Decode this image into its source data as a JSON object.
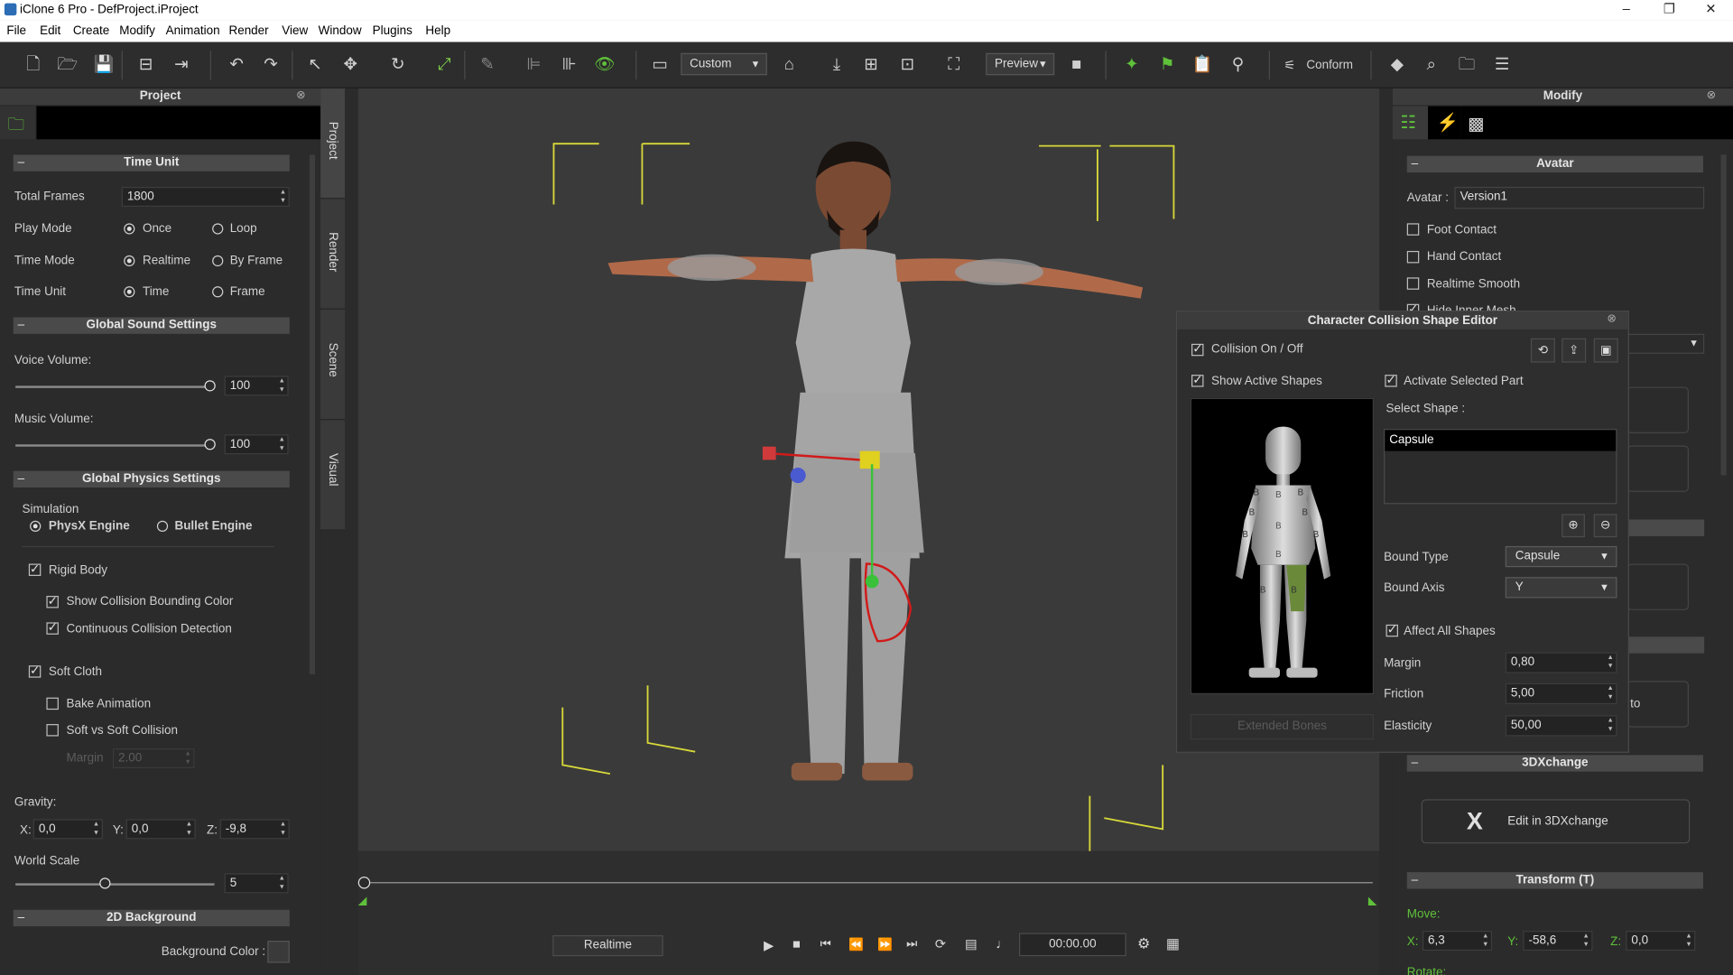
{
  "titlebar": {
    "title": "iClone 6 Pro - DefProject.iProject",
    "min": "–",
    "max": "❐",
    "close": "✕"
  },
  "menu": [
    "File",
    "Edit",
    "Create",
    "Modify",
    "Animation",
    "Render",
    "View",
    "Window",
    "Plugins",
    "Help"
  ],
  "toolbar": {
    "view_dropdown": "Custom",
    "preview_dropdown": "Preview",
    "conform": "Conform"
  },
  "left": {
    "title": "Project",
    "time_unit": {
      "header": "Time Unit",
      "total_frames_label": "Total Frames",
      "total_frames": "1800",
      "play_mode_label": "Play Mode",
      "once": "Once",
      "loop": "Loop",
      "time_mode_label": "Time Mode",
      "realtime": "Realtime",
      "by_frame": "By Frame",
      "time_unit_label": "Time Unit",
      "time": "Time",
      "frame": "Frame"
    },
    "sound": {
      "header": "Global Sound Settings",
      "voice_label": "Voice Volume:",
      "voice": "100",
      "music_label": "Music Volume:",
      "music": "100"
    },
    "physics": {
      "header": "Global Physics Settings",
      "simulation": "Simulation",
      "physx": "PhysX Engine",
      "bullet": "Bullet Engine",
      "rigid_body": "Rigid Body",
      "show_bounding": "Show Collision Bounding Color",
      "continuous": "Continuous Collision Detection",
      "soft_cloth": "Soft Cloth",
      "bake": "Bake Animation",
      "soft_vs_soft": "Soft vs Soft Collision",
      "margin_label": "Margin",
      "margin": "2.00",
      "gravity_label": "Gravity:",
      "gx_label": "X:",
      "gx": "0,0",
      "gy_label": "Y:",
      "gy": "0,0",
      "gz_label": "Z:",
      "gz": "-9,8",
      "world_scale_label": "World Scale",
      "world_scale": "5"
    },
    "bg": {
      "header": "2D Background",
      "color_label": "Background Color :"
    }
  },
  "side_tabs": [
    "Project",
    "Render",
    "Scene",
    "Visual"
  ],
  "right": {
    "title": "Modify",
    "avatar": {
      "header": "Avatar",
      "avatar_label": "Avatar :",
      "avatar_value": "Version1",
      "foot": "Foot Contact",
      "hand": "Hand Contact",
      "smooth": "Realtime Smooth",
      "hide": "Hide Inner Mesh"
    },
    "x3d": {
      "header": "3DXchange",
      "edit": "Edit in 3DXchange"
    },
    "transform": {
      "header": "Transform  (T)",
      "move": "Move:",
      "x_label": "X:",
      "x": "6,3",
      "y_label": "Y:",
      "y": "-58,6",
      "z_label": "Z:",
      "z": "0,0",
      "rotate": "Rotate:"
    },
    "hidden_to": "to"
  },
  "dialog": {
    "title": "Character Collision Shape Editor",
    "collision": "Collision On / Off",
    "show_active": "Show Active Shapes",
    "activate": "Activate Selected Part",
    "select_shape": "Select Shape :",
    "shapes": [
      "Capsule"
    ],
    "bound_type_label": "Bound Type",
    "bound_type": "Capsule",
    "bound_axis_label": "Bound Axis",
    "bound_axis": "Y",
    "affect_all": "Affect All Shapes",
    "margin_label": "Margin",
    "margin": "0,80",
    "friction_label": "Friction",
    "friction": "5,00",
    "elasticity_label": "Elasticity",
    "elasticity": "50,00",
    "extended": "Extended Bones",
    "bone_marker": "B"
  },
  "playback": {
    "mode": "Realtime",
    "time": "00:00.00"
  },
  "colors": {
    "accent_green": "#5fc13a",
    "wire_red": "#d11a1a",
    "frame_yellow": "#d8d83a"
  }
}
